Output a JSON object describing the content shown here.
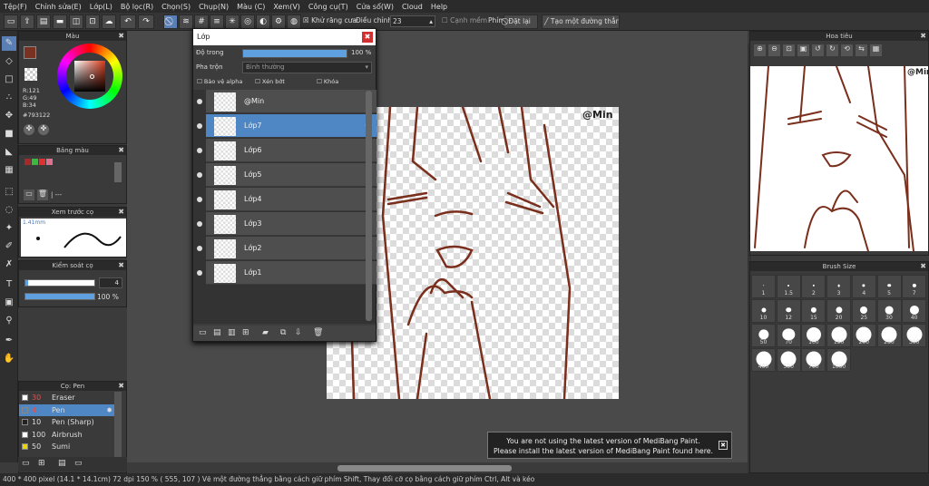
{
  "menu": [
    "Tệp(F)",
    "Chỉnh sửa(E)",
    "Lớp(L)",
    "Bộ lọc(R)",
    "Chọn(S)",
    "Chụp(N)",
    "Màu (C)",
    "Xem(V)",
    "Công cụ(T)",
    "Cửa sổ(W)",
    "Cloud",
    "Help"
  ],
  "toolbar": {
    "antialias": "Khử răng cưa",
    "correction_label": "Điều chỉnh",
    "correction_value": "23",
    "soft_edge": "Cạnh mềm",
    "pen_label": "Phím",
    "clear_label": "Đặt lại",
    "straight_label": "Tạo một đường thẳng"
  },
  "color_panel": {
    "title": "Màu",
    "r": "R:121",
    "g": "G:49",
    "b": "B:34",
    "hex": "#793122",
    "main_color": "#793122"
  },
  "palette_panel": {
    "title": "Bảng màu",
    "page": "| ---",
    "swatches": [
      "#a52a2a",
      "#3cb83c",
      "#e03030",
      "#e07090"
    ]
  },
  "preview_panel": {
    "title": "Xem trước cọ",
    "size": "1.41mm"
  },
  "brush_control": {
    "title": "Kiểm soát cọ",
    "size": "4",
    "opacity": "100 %"
  },
  "brush_list": {
    "title": "Cọ: Pen",
    "items": [
      {
        "size": "30",
        "name": "Eraser",
        "color": "#ffffff"
      },
      {
        "size": "4",
        "name": "Pen",
        "color": "#4e87c4"
      },
      {
        "size": "10",
        "name": "Pen (Sharp)",
        "color": "#222222"
      },
      {
        "size": "100",
        "name": "Airbrush",
        "color": "#ffffff"
      },
      {
        "size": "50",
        "name": "Sumi",
        "color": "#e8d800"
      }
    ]
  },
  "layer_window": {
    "title": "Lớp",
    "opacity_label": "Độ trong",
    "opacity_value": "100 %",
    "blend_label": "Pha trộn",
    "blend_value": "Bình thường",
    "protect": "Bảo vệ alpha",
    "clip": "Xén bớt",
    "lock": "Khóa",
    "layers": [
      "@Min",
      "Lớp7",
      "Lớp6",
      "Lớp5",
      "Lớp4",
      "Lớp3",
      "Lớp2",
      "Lớp1"
    ],
    "selected": 1
  },
  "canvas": {
    "signature": "@Min"
  },
  "navigator": {
    "title": "Hoa tiêu",
    "signature": "@Min"
  },
  "brush_size": {
    "title": "Brush Size",
    "sizes": [
      "1",
      "1.5",
      "2",
      "3",
      "4",
      "5",
      "7",
      "10",
      "12",
      "15",
      "20",
      "25",
      "30",
      "40",
      "50",
      "70",
      "100",
      "150",
      "200",
      "250",
      "300",
      "400",
      "500",
      "700",
      "1000"
    ]
  },
  "notification": {
    "line1": "You are not using the latest version of MediBang Paint.",
    "line2": "Please install the latest version of MediBang Paint found here."
  },
  "status": {
    "dims": "400 * 400 pixel",
    "phys": "(14.1 * 14.1cm)",
    "dpi": "72 dpi",
    "zoom": "150 %",
    "coords": "( 555, 107 )",
    "hint": "Vẽ một đường thẳng bằng cách giữ phím Shift, Thay đổi cỡ cọ bằng cách giữ phím Ctrl, Alt và kéo"
  }
}
